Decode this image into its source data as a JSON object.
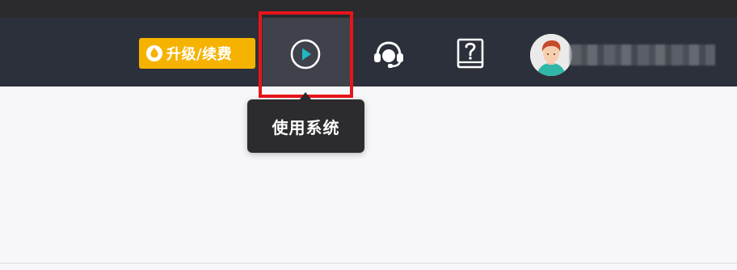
{
  "header": {
    "upgrade_button_label": "升级/续费",
    "play_button_icon": "play-circle-icon",
    "support_button_icon": "headset-icon",
    "help_button_icon": "help-book-icon",
    "avatar_icon": "user-avatar-icon"
  },
  "tooltip": {
    "text": "使用系统"
  },
  "colors": {
    "header_bg": "#2c303a",
    "upgrade_bg": "#f5b300",
    "highlight_border": "#e8141a",
    "play_accent": "#1fb8c4",
    "tooltip_bg": "#2c2c2e"
  }
}
